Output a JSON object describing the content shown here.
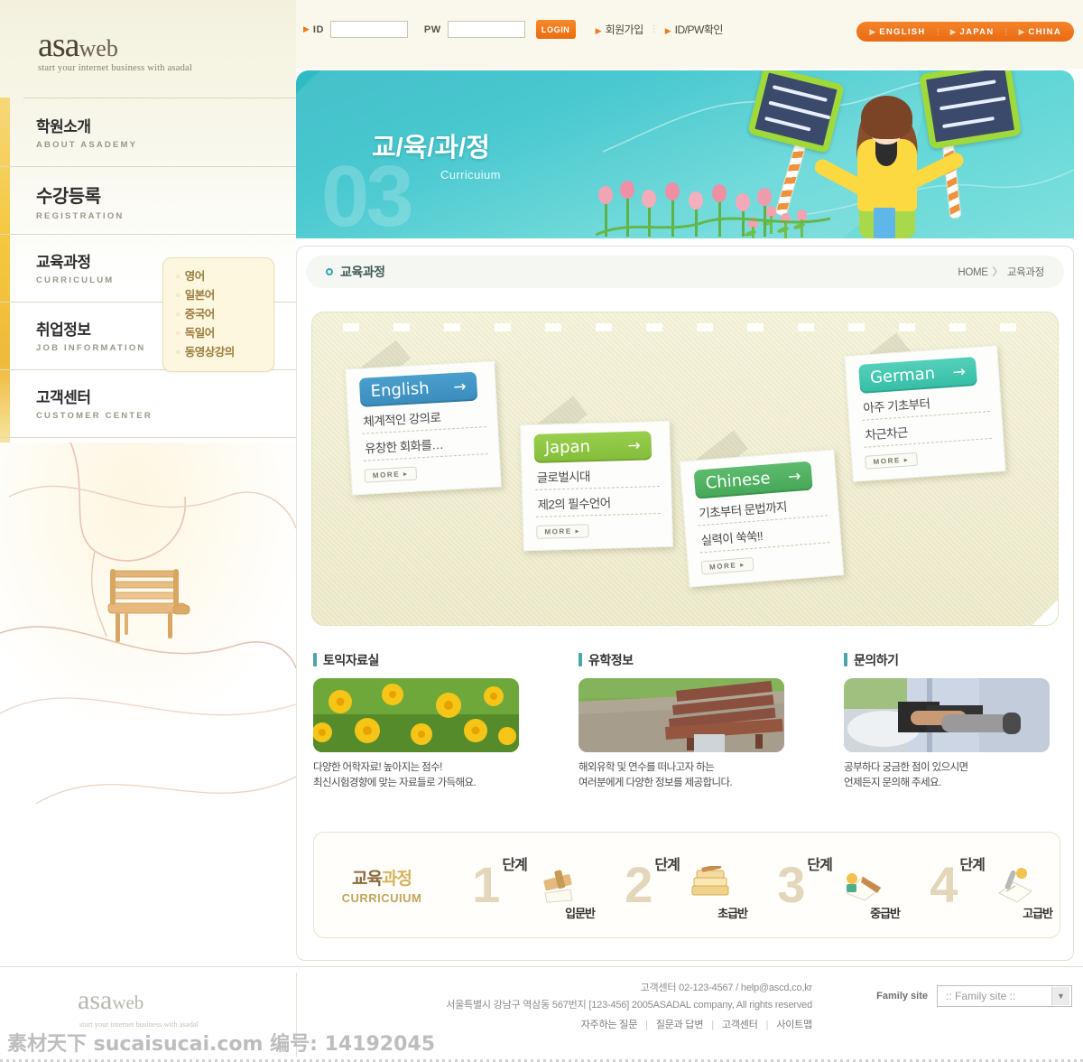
{
  "brand": {
    "logo_main": "asa",
    "logo_sub": "web",
    "tagline": "start your internet business with asadal"
  },
  "topbar": {
    "id_label": "ID",
    "id_value": "",
    "id_placeholder": "",
    "pw_label": "PW",
    "pw_value": "",
    "pw_placeholder": "",
    "login_button": "LOGIN",
    "signup_link": "회원가입",
    "findid_link": "ID/PW확인",
    "languages": [
      "ENGLISH",
      "JAPAN",
      "CHINA"
    ]
  },
  "sidebar": {
    "items": [
      {
        "ko": "학원소개",
        "en": "ABOUT ASADEMY"
      },
      {
        "ko": "수강등록",
        "en": "REGISTRATION"
      },
      {
        "ko": "교육과정",
        "en": "CURRICULUM"
      },
      {
        "ko": "취업정보",
        "en": "JOB INFORMATION"
      },
      {
        "ko": "고객센터",
        "en": "CUSTOMER CENTER"
      }
    ],
    "submenu": [
      "영어",
      "일본어",
      "중국어",
      "독일어",
      "동영상강의"
    ]
  },
  "banner": {
    "title": "교/육/과/정",
    "subtitle": "Curricuium",
    "number": "03"
  },
  "page": {
    "title": "교육과정",
    "breadcrumb_home": "HOME",
    "breadcrumb_sep": "〉",
    "breadcrumb_current": "교육과정"
  },
  "cards": [
    {
      "label": "English",
      "arrow": "→",
      "line1": "체계적인 강의로",
      "line2": "유창한 회화를…",
      "more": "MORE ▸",
      "color": "#3a92c4"
    },
    {
      "label": "Japan",
      "arrow": "→",
      "line1": "글로벌시대",
      "line2": "제2의 필수언어",
      "more": "MORE ▸",
      "color": "#8cc63f"
    },
    {
      "label": "Chinese",
      "arrow": "→",
      "line1": "기초부터 문법까지",
      "line2": "실력이 쑥쑥!!",
      "more": "MORE ▸",
      "color": "#4caf63"
    },
    {
      "label": "German",
      "arrow": "→",
      "line1": "아주 기초부터",
      "line2": "차근차근",
      "more": "MORE ▸",
      "color": "#3fc4ac"
    }
  ],
  "features": [
    {
      "heading": "토익자료실",
      "line1": "다양한 어학자료! 높아지는 점수!",
      "line2": "최신시험경향에 맞는 자료들로 가득해요."
    },
    {
      "heading": "유학정보",
      "line1": "해외유학 및 연수를 떠나고자 하는",
      "line2": "여러분에게 다양한 정보를 제공합니다."
    },
    {
      "heading": "문의하기",
      "line1": "공부하다 궁금한 점이 있으시면",
      "line2": "언제든지 문의해 주세요."
    }
  ],
  "steps": {
    "label_ko_a": "교육",
    "label_ko_b": "과정",
    "label_en": "CURRICUIUM",
    "items": [
      {
        "num": "1",
        "unit": "단계",
        "name": "입문반"
      },
      {
        "num": "2",
        "unit": "단계",
        "name": "초급반"
      },
      {
        "num": "3",
        "unit": "단계",
        "name": "중급반"
      },
      {
        "num": "4",
        "unit": "단계",
        "name": "고급반"
      }
    ]
  },
  "footer": {
    "logo_main": "asa",
    "logo_sub": "web",
    "tagline": "start your internet business with asadal",
    "contact": "고객센터 02-123-4567 / help@ascd,co,kr",
    "address": "서울특별시 강남구 역삼동 567번지 [123-456] 2005ASADAL company, All rights reserved",
    "links": [
      "자주하는 질문",
      "질문과 답변",
      "고객센터",
      "사이트맵"
    ],
    "family_label": "Family site",
    "family_selected": ":: Family site ::",
    "family_caret": "▼"
  },
  "watermark": "素材天下 sucaisucai.com  编号: 14192045"
}
